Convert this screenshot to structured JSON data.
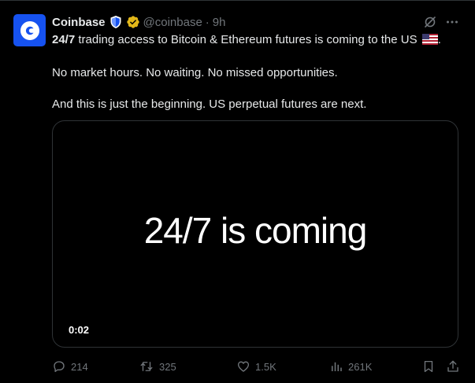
{
  "tweet": {
    "author_name": "Coinbase",
    "handle": "@coinbase",
    "separator": "·",
    "time": "9h",
    "text_bold": "24/7",
    "text_line1_rest": " trading access to Bitcoin & Ethereum futures is coming to the US",
    "text_line1_end": ".",
    "text_line2": "No market hours. No waiting. No missed opportunities.",
    "text_line3": "And this is just the beginning. US perpetual futures are next."
  },
  "media": {
    "title": "24/7 is coming",
    "timestamp": "0:02"
  },
  "actions": {
    "replies": "214",
    "reposts": "325",
    "likes": "1.5K",
    "views": "261K"
  },
  "colors": {
    "background": "#000000",
    "brand_blue": "#1652f0",
    "text_primary": "#e7e9ea",
    "text_secondary": "#71767b",
    "border": "#2f3336"
  }
}
